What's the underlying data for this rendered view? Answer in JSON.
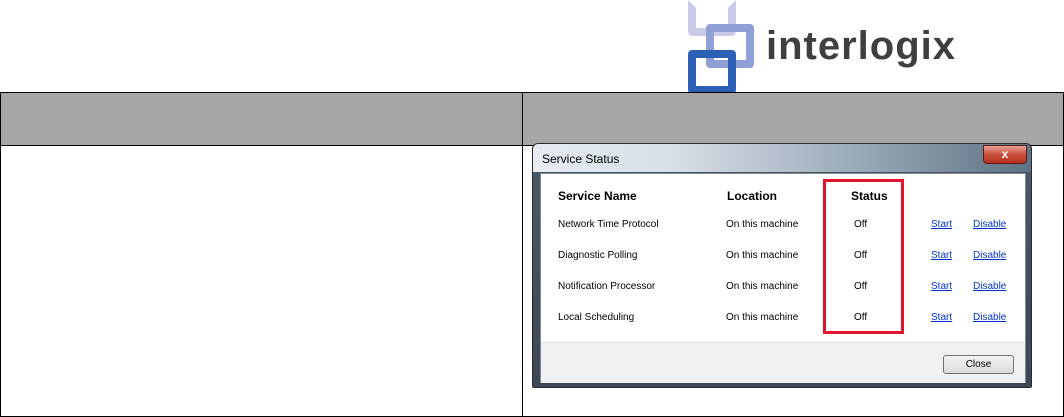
{
  "logo": {
    "text": "interlogix"
  },
  "dialog": {
    "title": "Service Status",
    "close_glyph": "x",
    "columns": {
      "name": "Service Name",
      "location": "Location",
      "status": "Status"
    },
    "rows": [
      {
        "name": "Network Time Protocol",
        "location": "On this machine",
        "status": "Off",
        "start": "Start",
        "disable": "Disable"
      },
      {
        "name": "Diagnostic Polling",
        "location": "On this machine",
        "status": "Off",
        "start": "Start",
        "disable": "Disable"
      },
      {
        "name": "Notification Processor",
        "location": "On this machine",
        "status": "Off",
        "start": "Start",
        "disable": "Disable"
      },
      {
        "name": "Local Scheduling",
        "location": "On this machine",
        "status": "Off",
        "start": "Start",
        "disable": "Disable"
      }
    ],
    "close_button": "Close"
  },
  "colors": {
    "header_fill": "#a6a6a6",
    "highlight": "#e3142a",
    "link": "#0033cc"
  }
}
